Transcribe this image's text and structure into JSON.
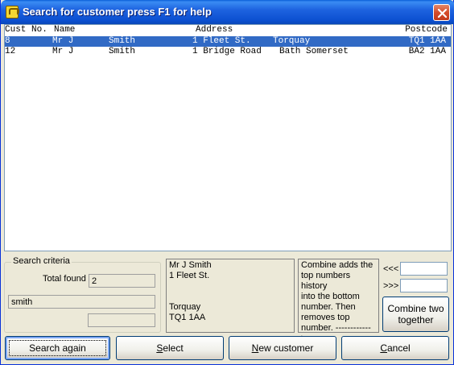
{
  "window": {
    "title": "Search for customer press F1 for help"
  },
  "list": {
    "headers": {
      "cust_no": "Cust No.",
      "name": "Name",
      "address": "Address",
      "postcode": "Postcode"
    },
    "rows": [
      {
        "cust_no": "8",
        "title": "Mr J",
        "surname": "Smith",
        "address": "1 Fleet St.",
        "town": "Torquay",
        "postcode": "TQ1 1AA",
        "selected": true
      },
      {
        "cust_no": "12",
        "title": "Mr J",
        "surname": "Smith",
        "address": "1 Bridge Road",
        "town": "Bath Somerset",
        "postcode": "BA2 1AA",
        "selected": false
      }
    ]
  },
  "search_criteria": {
    "legend": "Search criteria",
    "total_found_label": "Total found",
    "total_found_value": "2",
    "search_text": "smith",
    "extra_field": ""
  },
  "address_preview": {
    "lines": [
      "Mr J Smith",
      "1 Fleet St.",
      "",
      "",
      "Torquay",
      "TQ1 1AA"
    ]
  },
  "combine_help": {
    "text_lines": [
      "Combine adds the",
      "top numbers history",
      "into the bottom",
      "number.  Then",
      "removes top",
      "number. ------------>"
    ]
  },
  "combine": {
    "top_label": "<<<",
    "bottom_label": ">>>",
    "top_value": "",
    "bottom_value": "",
    "button_line1": "Combine two",
    "button_line2": "together"
  },
  "buttons": {
    "search_again": "Search again",
    "select_first": "S",
    "select_rest": "elect",
    "new_customer_first": "N",
    "new_customer_rest": "ew customer",
    "cancel_first": "C",
    "cancel_rest": "ancel"
  },
  "colors": {
    "selection": "#316AC5",
    "titlebar": "#0B4FD0",
    "window_bg": "#ECE9D8"
  },
  "icons": {
    "app": "app-icon",
    "close": "close-icon"
  }
}
